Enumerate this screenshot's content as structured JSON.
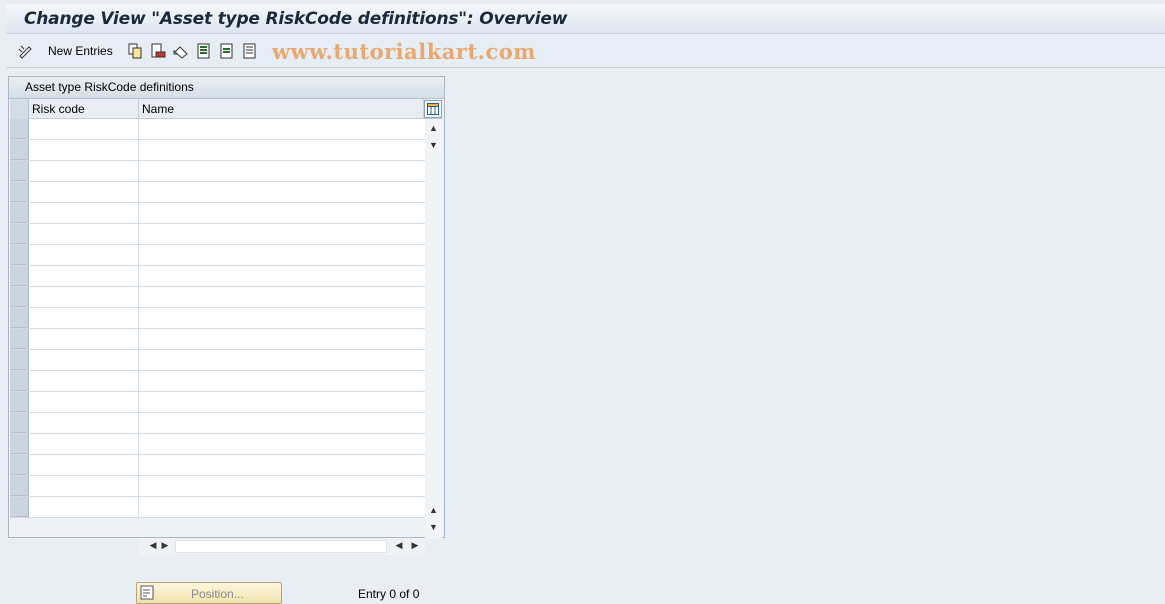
{
  "title": "Change View \"Asset type RiskCode definitions\": Overview",
  "toolbar": {
    "new_entries_label": "New Entries",
    "watermark": "www.tutorialkart.com",
    "icons": [
      "display-change-icon",
      "copy-icon",
      "delete-icon",
      "undo-icon",
      "select-all-icon",
      "select-block-icon",
      "deselect-all-icon"
    ]
  },
  "table": {
    "title": "Asset type RiskCode definitions",
    "columns": [
      "Risk code",
      "Name"
    ],
    "row_count": 19
  },
  "footer": {
    "position_label": "Position...",
    "entry_text": "Entry 0 of 0"
  },
  "colors": {
    "title_text": "#1a2a3a",
    "watermark": "#e8a971",
    "background": "#e8eef4"
  }
}
